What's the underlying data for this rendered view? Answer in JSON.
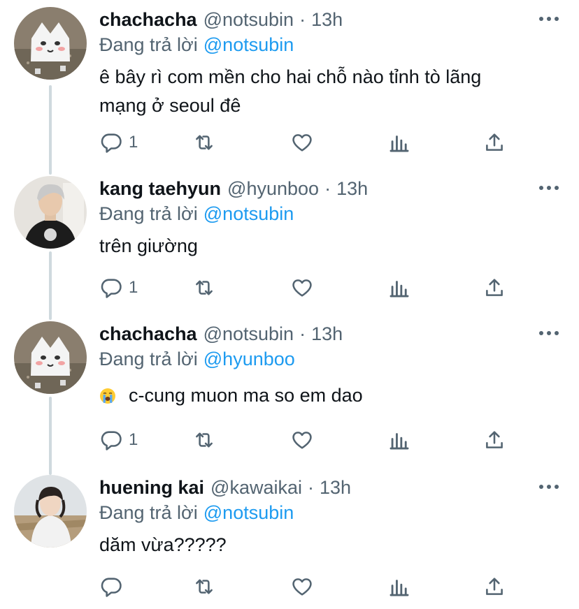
{
  "colors": {
    "text": "#0f1419",
    "secondary": "#536471",
    "link": "#1d9bf0",
    "thread_line": "#cfd9de",
    "background": "#ffffff"
  },
  "tweets": [
    {
      "name": "chachacha",
      "handle": "@notsubin",
      "separator": "·",
      "time": "13h",
      "replying_prefix": "Đang trả lời",
      "replying_to": "@notsubin",
      "text_line1": "ê bây rì com mền cho hai chỗ nào tỉnh tò lãng",
      "text_line2": "mạng ở seoul đê",
      "reply_count": "1",
      "avatar_icon": "cartoon-cat-in-sand-avatar"
    },
    {
      "name": "kang taehyun",
      "handle": "@hyunboo",
      "separator": "·",
      "time": "13h",
      "replying_prefix": "Đang trả lời",
      "replying_to": "@notsubin",
      "text_line1": "trên giường",
      "reply_count": "1",
      "avatar_icon": "person-hoodie-photo-avatar"
    },
    {
      "name": "chachacha",
      "handle": "@notsubin",
      "separator": "·",
      "time": "13h",
      "replying_prefix": "Đang trả lời",
      "replying_to": "@hyunboo",
      "text_line1": "c-cung muon ma so em dao",
      "emoji_icon": "loudly-crying-face-emoji",
      "reply_count": "1",
      "avatar_icon": "cartoon-cat-in-sand-avatar"
    },
    {
      "name": "huening kai",
      "handle": "@kawaikai",
      "separator": "·",
      "time": "13h",
      "replying_prefix": "Đang trả lời",
      "replying_to": "@notsubin",
      "text_line1": "dăm vừa?????",
      "reply_count": "",
      "avatar_icon": "person-field-photo-avatar"
    }
  ]
}
